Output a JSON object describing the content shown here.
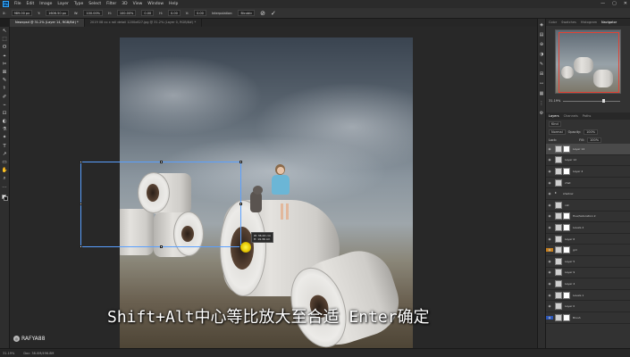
{
  "menubar": {
    "logo": "Ps",
    "items": [
      "File",
      "Edit",
      "Image",
      "Layer",
      "Type",
      "Select",
      "Filter",
      "3D",
      "View",
      "Window",
      "Help"
    ],
    "window_controls": [
      "—",
      "▢",
      "✕"
    ]
  },
  "options": {
    "fields": [
      "X:",
      "989.00 px",
      "Y:",
      "1606.50 px",
      "W:",
      "100.00%",
      "H:",
      "100.00%",
      "0.00",
      "H:",
      "0.00",
      "V:",
      "0.00",
      "Interpolation:",
      "Bicubic"
    ],
    "confirm_icons": [
      "⊘",
      "✓"
    ]
  },
  "tabs": [
    {
      "label": "Newcpsd @ 31.2% (Layer 14, RGB/8#) *",
      "active": true
    },
    {
      "label": "2019 08 co x roll detail 1200x627.jpg @ 31.2% (Layer 0, RGB/8#) *",
      "active": false
    }
  ],
  "tools": [
    "↖",
    "⬚",
    "ʘ",
    "⌖",
    "✂",
    "⊠",
    "✎",
    "⚕",
    "✐",
    "⌁",
    "⊡",
    "◐",
    "⚗",
    "✦",
    "T",
    "↗",
    "▭",
    "✋",
    "⌕",
    "⋯"
  ],
  "caption": "Shift+Alt中心等比放大至合适 Enter确定",
  "watermark": "RAFYA88",
  "tooltip": {
    "line1": "W: 36.24 cm",
    "line2": "H: 19.36 cm"
  },
  "statusbar": {
    "zoom": "31.19%",
    "doc": "Doc: 38.0M/496.8M"
  },
  "iconstrip": [
    "◈",
    "▤",
    "⊕",
    "◑",
    "✎",
    "⊞",
    "ꟷ",
    "▦",
    "⋮",
    "⚙"
  ],
  "right_panel": {
    "tabs": [
      {
        "label": "Color",
        "active": false
      },
      {
        "label": "Swatches",
        "active": false
      },
      {
        "label": "Histogram",
        "active": false
      },
      {
        "label": "Navigator",
        "active": true
      }
    ],
    "zoom": "31.19%",
    "layers_tabs": [
      {
        "label": "Layers",
        "active": true
      },
      {
        "label": "Channels",
        "active": false
      },
      {
        "label": "Paths",
        "active": false
      }
    ],
    "kind_label": "Kind",
    "blend_mode": "Normal",
    "opacity_label": "Opacity:",
    "opacity": "100%",
    "lock_label": "Lock:",
    "fill_label": "Fill:",
    "fill": "100%",
    "layers": [
      {
        "name": "Layer 14",
        "type": "layer",
        "selected": true,
        "mask": true
      },
      {
        "name": "Layer 12",
        "type": "layer",
        "selected": false,
        "mask": false
      },
      {
        "name": "Layer 4",
        "type": "layer",
        "selected": false,
        "mask": true
      },
      {
        "name": "chat",
        "type": "layer",
        "selected": false,
        "mask": false
      },
      {
        "name": "shadow",
        "type": "group",
        "selected": false,
        "mask": false
      },
      {
        "name": "cat",
        "type": "layer",
        "selected": false,
        "mask": false
      },
      {
        "name": "Hue/Saturation 2",
        "type": "layer",
        "selected": false,
        "mask": true
      },
      {
        "name": "Levels 2",
        "type": "layer",
        "selected": false,
        "mask": true
      },
      {
        "name": "Layer 6",
        "type": "layer",
        "selected": false,
        "mask": false
      },
      {
        "name": "girl",
        "type": "layer",
        "selected": false,
        "mask": true,
        "orange": true
      },
      {
        "name": "Layer 5",
        "type": "layer",
        "selected": false,
        "mask": false
      },
      {
        "name": "Layer 9",
        "type": "layer",
        "selected": false,
        "mask": false
      },
      {
        "name": "Layer 4",
        "type": "layer",
        "selected": false,
        "mask": false
      },
      {
        "name": "Levels 1",
        "type": "layer",
        "selected": false,
        "mask": true
      },
      {
        "name": "Layer 0",
        "type": "layer",
        "selected": false,
        "mask": false
      },
      {
        "name": "Brush",
        "type": "layer",
        "selected": false,
        "mask": true,
        "blue": true
      }
    ]
  }
}
